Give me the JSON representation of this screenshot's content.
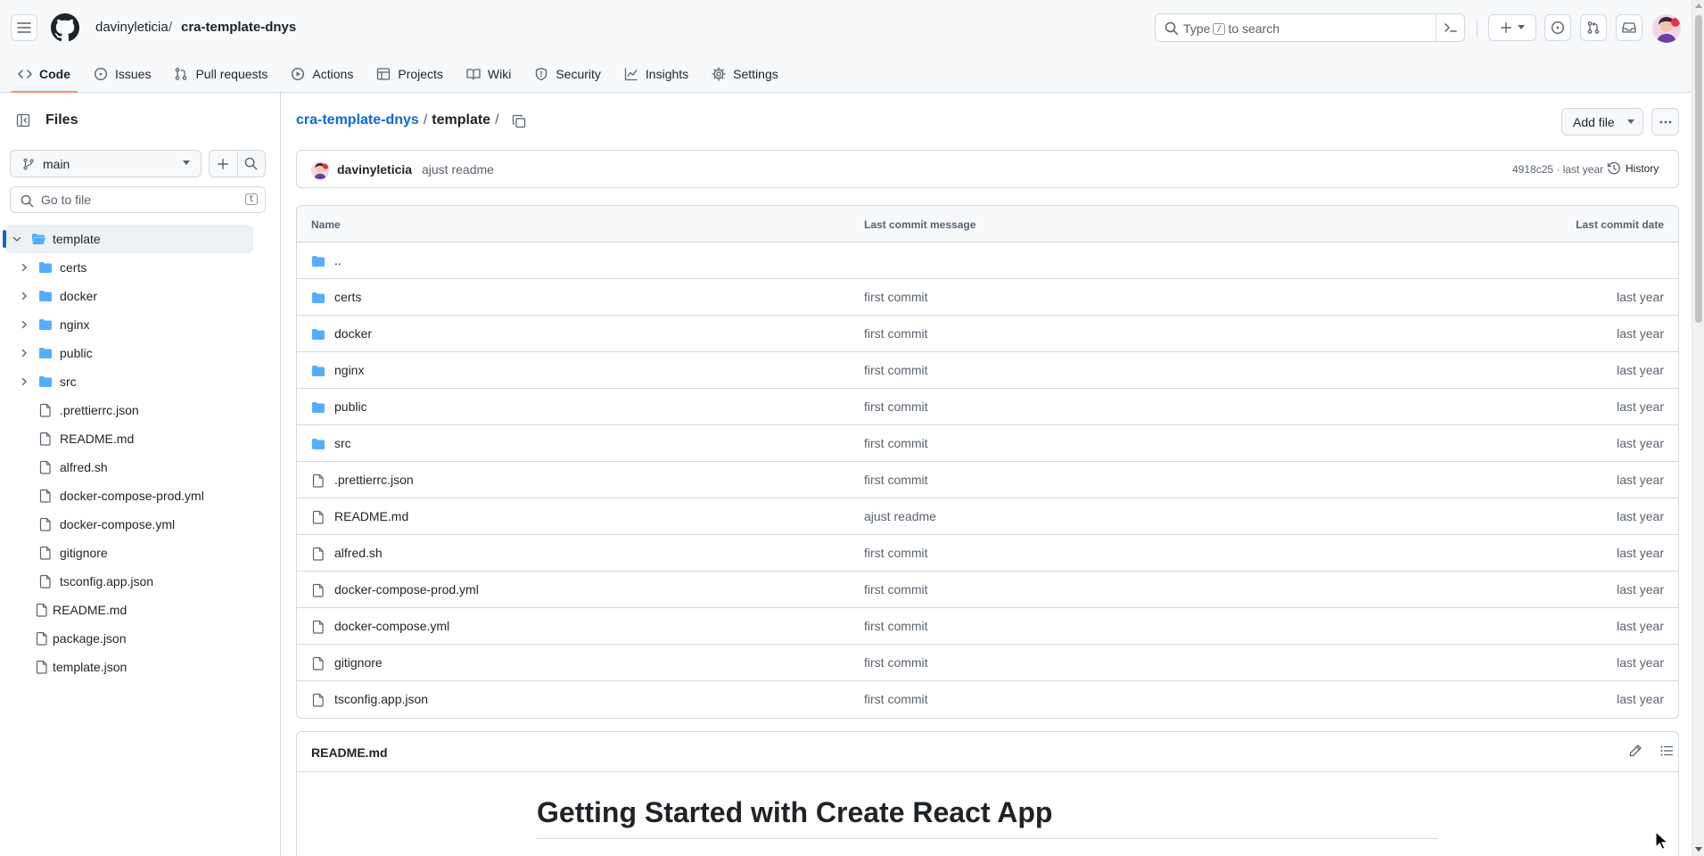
{
  "header": {
    "owner": "davinyleticia",
    "separator": "/",
    "repo": "cra-template-dnys",
    "search": {
      "prefix": "Type",
      "key": "/",
      "suffix": "to search"
    },
    "icons": [
      "menu-icon",
      "github-logo-icon",
      "search-icon",
      "command-palette-icon",
      "plus-icon",
      "issues-icon",
      "pull-requests-icon",
      "inbox-icon"
    ]
  },
  "tabs": [
    {
      "label": "Code",
      "icon": "code-icon",
      "active": true
    },
    {
      "label": "Issues",
      "icon": "issue-opened-icon"
    },
    {
      "label": "Pull requests",
      "icon": "git-pull-request-icon"
    },
    {
      "label": "Actions",
      "icon": "play-icon"
    },
    {
      "label": "Projects",
      "icon": "table-icon"
    },
    {
      "label": "Wiki",
      "icon": "book-icon"
    },
    {
      "label": "Security",
      "icon": "shield-icon"
    },
    {
      "label": "Insights",
      "icon": "graph-icon"
    },
    {
      "label": "Settings",
      "icon": "gear-icon"
    }
  ],
  "sidebar": {
    "title": "Files",
    "branch": "main",
    "goto_placeholder": "Go to file",
    "goto_key": "t",
    "tree": [
      {
        "label": "template",
        "type": "folder-open",
        "depth": 0,
        "expanded": true,
        "selected": true
      },
      {
        "label": "certs",
        "type": "folder",
        "depth": 1
      },
      {
        "label": "docker",
        "type": "folder",
        "depth": 1
      },
      {
        "label": "nginx",
        "type": "folder",
        "depth": 1
      },
      {
        "label": "public",
        "type": "folder",
        "depth": 1
      },
      {
        "label": "src",
        "type": "folder",
        "depth": 1
      },
      {
        "label": ".prettierrc.json",
        "type": "file",
        "depth": 1
      },
      {
        "label": "README.md",
        "type": "file",
        "depth": 1
      },
      {
        "label": "alfred.sh",
        "type": "file",
        "depth": 1
      },
      {
        "label": "docker-compose-prod.yml",
        "type": "file",
        "depth": 1
      },
      {
        "label": "docker-compose.yml",
        "type": "file",
        "depth": 1
      },
      {
        "label": "gitignore",
        "type": "file",
        "depth": 1
      },
      {
        "label": "tsconfig.app.json",
        "type": "file",
        "depth": 1
      },
      {
        "label": "README.md",
        "type": "file",
        "depth": 0
      },
      {
        "label": "package.json",
        "type": "file",
        "depth": 0
      },
      {
        "label": "template.json",
        "type": "file",
        "depth": 0
      }
    ]
  },
  "main": {
    "path": {
      "repo": "cra-template-dnys",
      "sep1": "/",
      "current": "template",
      "sep2": "/"
    },
    "add_file_label": "Add file",
    "commit": {
      "author": "davinyleticia",
      "message": "ajust readme",
      "meta": "4918c25 · last year",
      "history_label": "History"
    },
    "table": {
      "headers": {
        "name": "Name",
        "message": "Last commit message",
        "date": "Last commit date"
      },
      "rows": [
        {
          "name": "..",
          "type": "folder",
          "message": "",
          "date": ""
        },
        {
          "name": "certs",
          "type": "folder",
          "message": "first commit",
          "date": "last year"
        },
        {
          "name": "docker",
          "type": "folder",
          "message": "first commit",
          "date": "last year"
        },
        {
          "name": "nginx",
          "type": "folder",
          "message": "first commit",
          "date": "last year"
        },
        {
          "name": "public",
          "type": "folder",
          "message": "first commit",
          "date": "last year"
        },
        {
          "name": "src",
          "type": "folder",
          "message": "first commit",
          "date": "last year"
        },
        {
          "name": ".prettierrc.json",
          "type": "file",
          "message": "first commit",
          "date": "last year"
        },
        {
          "name": "README.md",
          "type": "file",
          "message": "ajust readme",
          "date": "last year"
        },
        {
          "name": "alfred.sh",
          "type": "file",
          "message": "first commit",
          "date": "last year"
        },
        {
          "name": "docker-compose-prod.yml",
          "type": "file",
          "message": "first commit",
          "date": "last year"
        },
        {
          "name": "docker-compose.yml",
          "type": "file",
          "message": "first commit",
          "date": "last year"
        },
        {
          "name": "gitignore",
          "type": "file",
          "message": "first commit",
          "date": "last year"
        },
        {
          "name": "tsconfig.app.json",
          "type": "file",
          "message": "first commit",
          "date": "last year"
        }
      ]
    },
    "readme": {
      "title": "README.md",
      "heading": "Getting Started with Create React App"
    }
  },
  "colors": {
    "accent_link": "#0969da",
    "folder": "#54aeff",
    "tab_underline": "#fd8c73",
    "border": "#d1d9e0",
    "muted_text": "#59636e"
  }
}
